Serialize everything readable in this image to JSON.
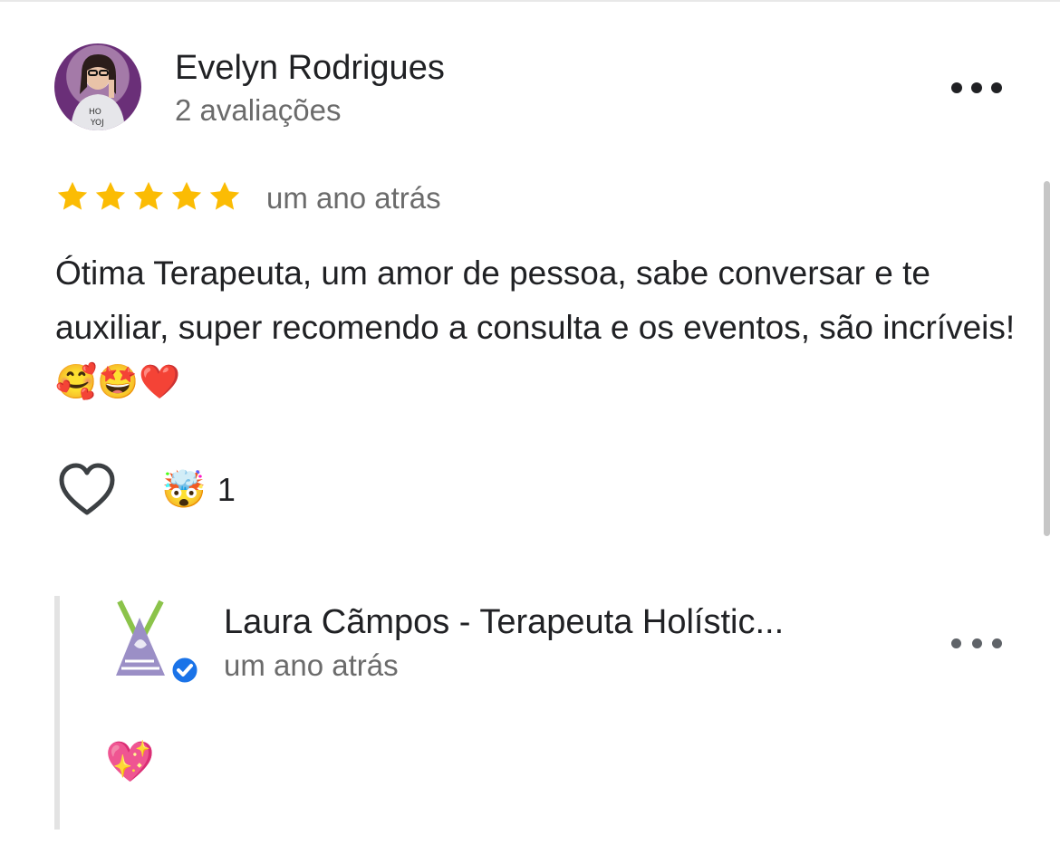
{
  "review": {
    "author_name": "Evelyn Rodrigues",
    "author_meta": "2 avaliações",
    "rating": 5,
    "date": "um ano atrás",
    "text": "Ótima Terapeuta, um amor de pessoa, sabe conversar e te auxiliar, super recomendo a consulta e os eventos, são incríveis! 🥰🤩❤️",
    "reaction_emoji": "🤯",
    "reaction_count": "1"
  },
  "reply": {
    "author_name": "Laura Cãmpos - Terapeuta Holístic...",
    "date": "um ano atrás",
    "text": "💖"
  },
  "icons": {
    "star_color": "#fbbc04",
    "verified_color": "#1a73e8",
    "logo_color": "#9b8fc6",
    "bamboo_color": "#8bc34a"
  }
}
